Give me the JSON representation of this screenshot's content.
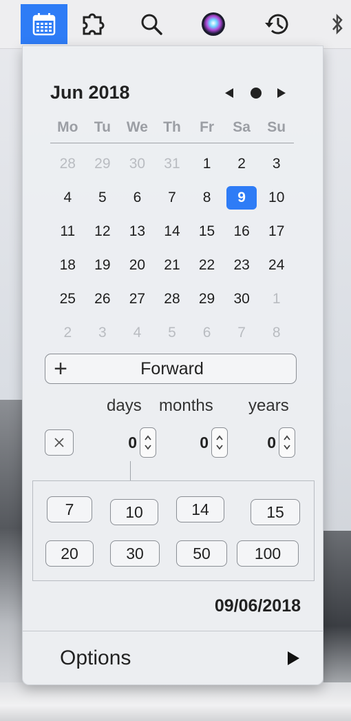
{
  "menubar": {
    "icons": [
      "calendar-icon",
      "puzzle-icon",
      "search-icon",
      "siri-icon",
      "time-machine-icon",
      "bluetooth-icon"
    ],
    "active_color": "#2e7cf6"
  },
  "calendar": {
    "month_title": "Jun 2018",
    "weekdays": [
      "Mo",
      "Tu",
      "We",
      "Th",
      "Fr",
      "Sa",
      "Su"
    ],
    "weeks": [
      [
        "28",
        "29",
        "30",
        "31",
        "1",
        "2",
        "3"
      ],
      [
        "4",
        "5",
        "6",
        "7",
        "8",
        "9",
        "10"
      ],
      [
        "11",
        "12",
        "13",
        "14",
        "15",
        "16",
        "17"
      ],
      [
        "18",
        "19",
        "20",
        "21",
        "22",
        "23",
        "24"
      ],
      [
        "25",
        "26",
        "27",
        "28",
        "29",
        "30",
        "1"
      ],
      [
        "2",
        "3",
        "4",
        "5",
        "6",
        "7",
        "8"
      ]
    ],
    "selected_day": "9"
  },
  "calculator": {
    "forward_label": "Forward",
    "units": {
      "days": "days",
      "months": "months",
      "years": "years"
    },
    "values": {
      "days": "0",
      "months": "0",
      "years": "0"
    },
    "quick_buttons": [
      "7",
      "10",
      "14",
      "15",
      "20",
      "30",
      "50",
      "100"
    ]
  },
  "result": {
    "date": "09/06/2018"
  },
  "options": {
    "label": "Options"
  }
}
